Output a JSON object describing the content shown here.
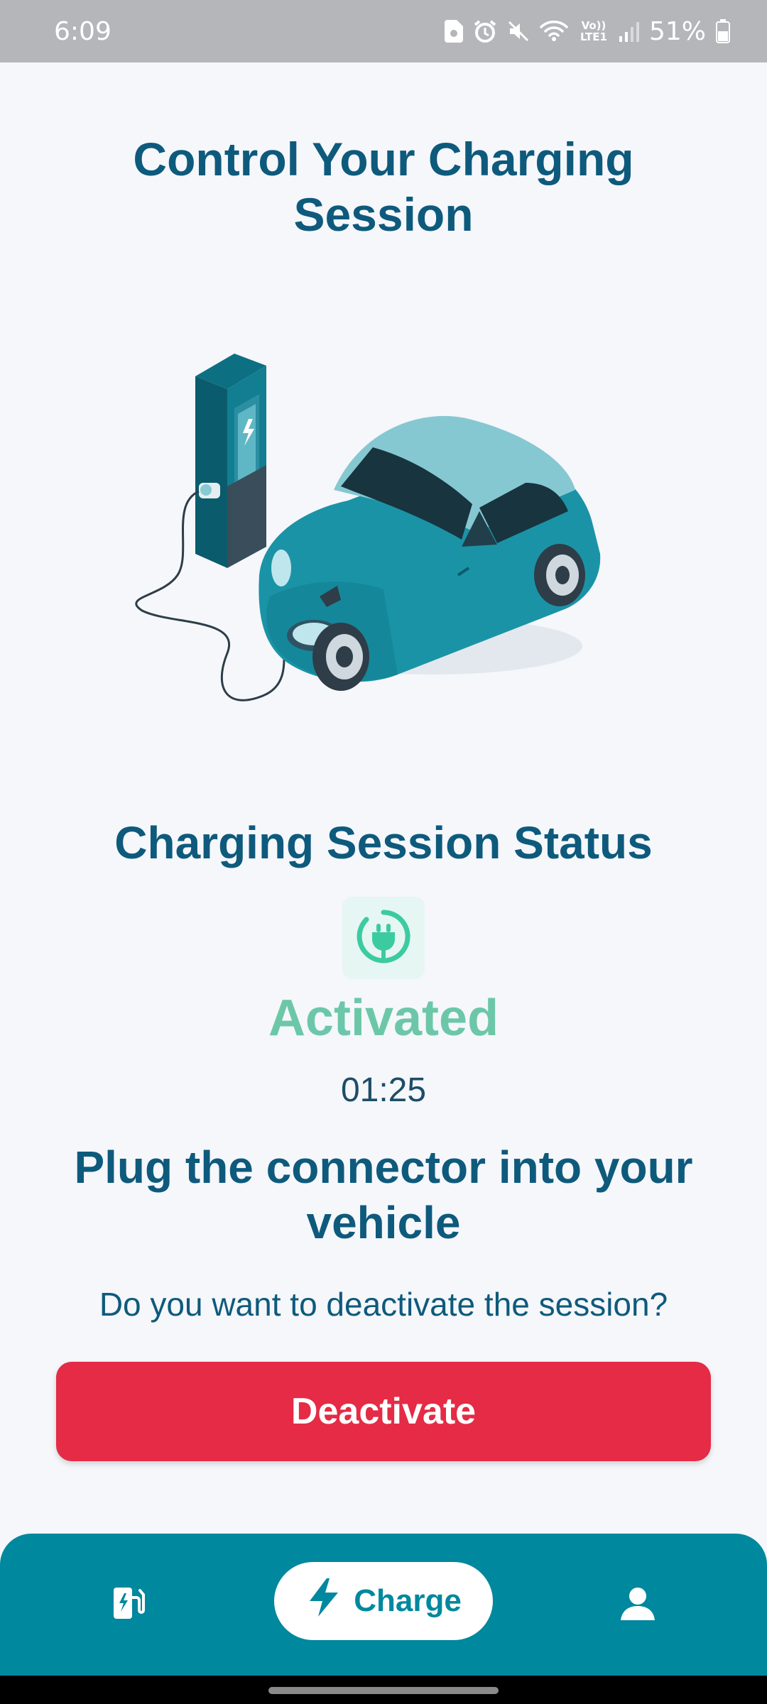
{
  "status_bar": {
    "time": "6:09",
    "battery": "51%",
    "network_label": "Vo)) LTE1",
    "icons": [
      "sim-card-icon",
      "alarm-icon",
      "mute-icon",
      "wifi-icon",
      "volte-icon",
      "signal-icon",
      "battery-icon"
    ]
  },
  "header": {
    "title": "Control Your Charging Session"
  },
  "hero": {
    "illustration": "ev-charging-illustration"
  },
  "session": {
    "section_title": "Charging Session Status",
    "status_icon": "plug-icon",
    "status": "Activated",
    "timer": "01:25",
    "instruction": "Plug the connector into your vehicle",
    "question": "Do you want to deactivate the session?",
    "deactivate_label": "Deactivate"
  },
  "bottom_nav": {
    "items": [
      {
        "icon": "charging-station-icon",
        "label": ""
      },
      {
        "icon": "lightning-icon",
        "label": "Charge",
        "active": true
      },
      {
        "icon": "profile-icon",
        "label": ""
      }
    ]
  },
  "colors": {
    "primary": "#0e5a7c",
    "accent": "#00889e",
    "activated": "#6cc7a8",
    "danger": "#e52b45",
    "background": "#f5f7fb"
  }
}
